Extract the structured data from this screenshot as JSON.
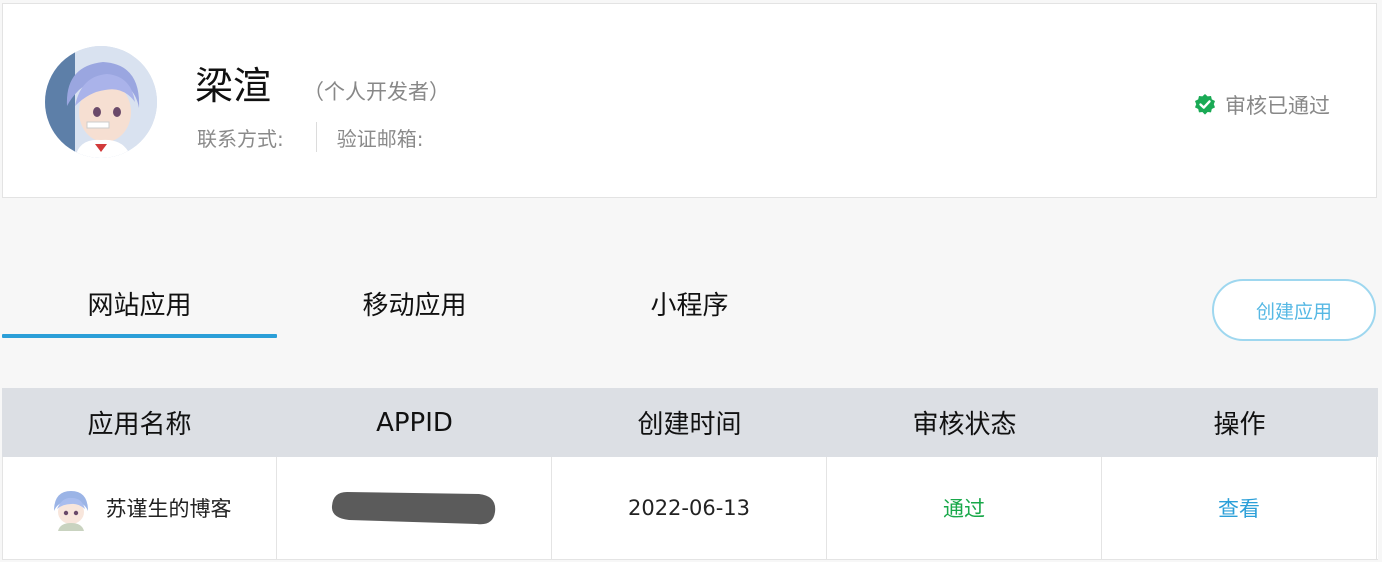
{
  "profile": {
    "name": "梁渲",
    "developer_type": "（个人开发者）",
    "contact_label": "联系方式:",
    "email_label": "验证邮箱:",
    "verify_status": "审核已通过",
    "verify_icon": "check-badge-icon",
    "verify_color": "#1aaa55"
  },
  "tabs": {
    "items": [
      {
        "label": "网站应用",
        "active": true
      },
      {
        "label": "移动应用",
        "active": false
      },
      {
        "label": "小程序",
        "active": false
      }
    ],
    "accent_color": "#2b9fd8"
  },
  "create_button_label": "创建应用",
  "table": {
    "headers": [
      "应用名称",
      "APPID",
      "创建时间",
      "审核状态",
      "操作"
    ],
    "rows": [
      {
        "name": "苏谨生的博客",
        "appid": "",
        "created": "2022-06-13",
        "status": "通过",
        "action": "查看"
      }
    ]
  }
}
